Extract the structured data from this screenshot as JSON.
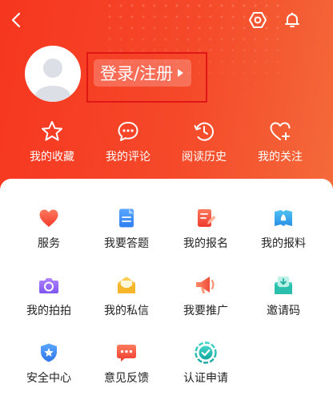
{
  "header": {
    "login_label": "登录/注册"
  },
  "quick_nav": [
    {
      "label": "我的收藏",
      "icon": "star-icon"
    },
    {
      "label": "我的评论",
      "icon": "comment-icon"
    },
    {
      "label": "阅读历史",
      "icon": "history-icon"
    },
    {
      "label": "我的关注",
      "icon": "heart-plus-icon"
    }
  ],
  "grid": [
    {
      "label": "服务",
      "icon": "heart-icon"
    },
    {
      "label": "我要答题",
      "icon": "quiz-icon"
    },
    {
      "label": "我的报名",
      "icon": "signup-icon"
    },
    {
      "label": "我的报料",
      "icon": "tip-off-icon"
    },
    {
      "label": "我的拍拍",
      "icon": "camera-icon"
    },
    {
      "label": "我的私信",
      "icon": "mail-icon"
    },
    {
      "label": "我要推广",
      "icon": "megaphone-icon"
    },
    {
      "label": "邀请码",
      "icon": "invite-icon"
    },
    {
      "label": "安全中心",
      "icon": "shield-icon"
    },
    {
      "label": "意见反馈",
      "icon": "feedback-icon"
    },
    {
      "label": "认证申请",
      "icon": "verified-icon"
    }
  ],
  "colors": {
    "brand_red": "#f6361f",
    "login_highlight": "#e11717"
  }
}
